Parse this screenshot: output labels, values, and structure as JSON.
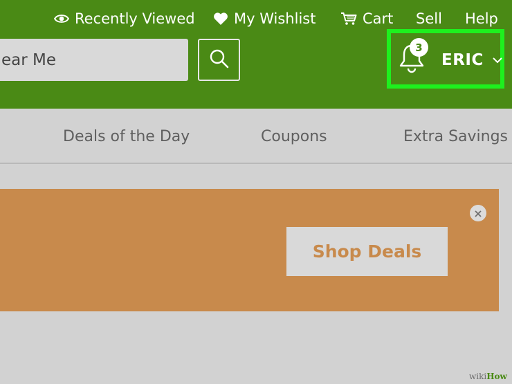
{
  "header": {
    "background": "#4a8a15",
    "top_links": [
      {
        "label": "Recently Viewed",
        "icon": "eye-icon"
      },
      {
        "label": "My Wishlist",
        "icon": "heart-icon"
      },
      {
        "label": "Cart",
        "icon": "cart-icon"
      },
      {
        "label": "Sell"
      },
      {
        "label": "Help"
      }
    ],
    "search": {
      "value": "ear Me",
      "button_icon": "search-icon"
    },
    "notifications": {
      "icon": "bell-icon",
      "count": "3"
    },
    "user": {
      "name": "ERIC",
      "icon": "chevron-down-icon",
      "highlight_color": "#1ef01e"
    }
  },
  "nav": {
    "items": [
      "Deals of the Day",
      "Coupons",
      "Extra Savings"
    ]
  },
  "banner": {
    "background": "#c88a4c",
    "button_label": "Shop Deals",
    "close_icon": "close-icon"
  },
  "watermark": {
    "prefix": "wiki",
    "suffix": "How"
  }
}
